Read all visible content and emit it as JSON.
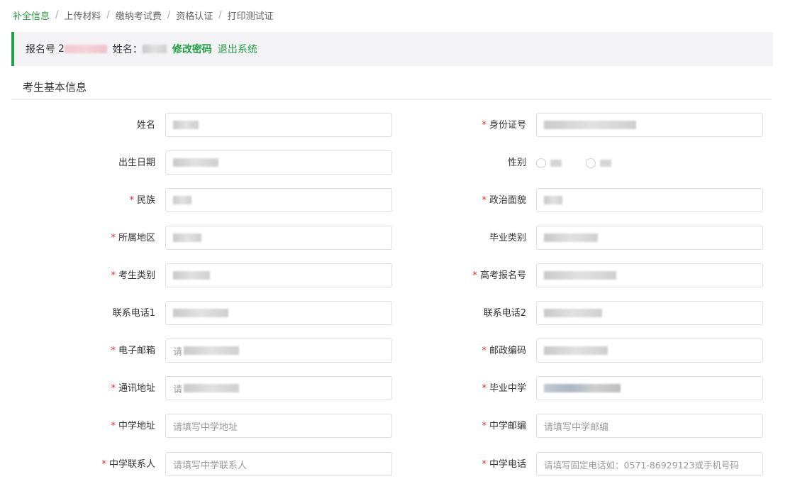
{
  "breadcrumb": [
    "补全信息",
    "上传材料",
    "缴纳考试费",
    "资格认证",
    "打印测试证"
  ],
  "infobar": {
    "reg_label": "报名号",
    "reg_prefix": "2",
    "name_label": "姓名：",
    "change_password": "修改密码",
    "logout": "退出系统"
  },
  "section_title": "考生基本信息",
  "colors": {
    "accent": "#22a045",
    "required": "#e02a2a"
  },
  "fields": {
    "name": {
      "label": "姓名",
      "required": false
    },
    "id_number": {
      "label": "身份证号",
      "required": true
    },
    "birth_date": {
      "label": "出生日期",
      "required": false
    },
    "gender": {
      "label": "性别",
      "required": false
    },
    "ethnicity": {
      "label": "民族",
      "required": true
    },
    "political_status": {
      "label": "政治面貌",
      "required": true
    },
    "region": {
      "label": "所属地区",
      "required": true
    },
    "graduation_type": {
      "label": "毕业类别",
      "required": false
    },
    "candidate_type": {
      "label": "考生类别",
      "required": true
    },
    "gaokao_number": {
      "label": "高考报名号",
      "required": true
    },
    "phone1": {
      "label": "联系电话1",
      "required": false
    },
    "phone2": {
      "label": "联系电话2",
      "required": false
    },
    "email": {
      "label": "电子邮箱",
      "required": true,
      "placeholder": "请"
    },
    "postcode": {
      "label": "邮政编码",
      "required": true
    },
    "address": {
      "label": "通讯地址",
      "required": true,
      "placeholder": "请"
    },
    "high_school": {
      "label": "毕业中学",
      "required": true
    },
    "school_address": {
      "label": "中学地址",
      "required": true,
      "placeholder": "请填写中学地址"
    },
    "school_postcode": {
      "label": "中学邮编",
      "required": true,
      "placeholder": "请填写中学邮编"
    },
    "school_contact": {
      "label": "中学联系人",
      "required": true,
      "placeholder": "请填写中学联系人"
    },
    "school_phone": {
      "label": "中学电话",
      "required": true,
      "placeholder": "请填写固定电话如：0571-86929123或手机号码"
    }
  }
}
